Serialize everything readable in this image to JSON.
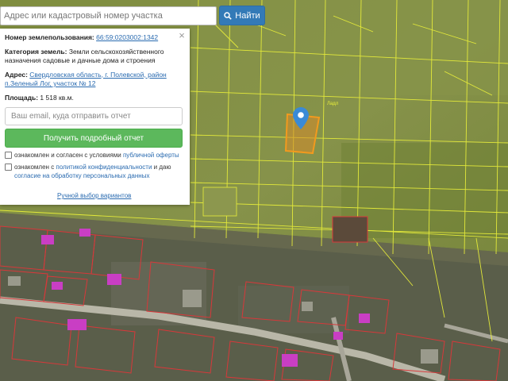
{
  "search": {
    "placeholder": "Адрес или кадастровый номер участка",
    "button_label": "Найти"
  },
  "panel": {
    "cadastral_label": "Номер землепользования:",
    "cadastral_number": "66:59:0203002:1342",
    "category_label": "Категория земель:",
    "category_value": "Земли сельскохозяйственного назначения садовые и дачные дома и строения",
    "address_label": "Адрес:",
    "address_value": "Свердловская область, г. Полевской, район п.Зеленый Лог, участок № 12",
    "area_label": "Площадь:",
    "area_value": "1 518 кв.м.",
    "email_placeholder": "Ваш email, куда отправить отчет",
    "report_button": "Получить подробный отчет",
    "consent1_text": "ознакомлен и согласен с условиями ",
    "consent1_link": "публичной оферты",
    "consent2_text": "ознакомлен с ",
    "consent2_link1": "политикой конфиденциальности",
    "consent2_mid": " и даю ",
    "consent2_link2": "согласие на обработку персональных данных",
    "manual_link": "Ручной выбор вариантов",
    "close_glyph": "×"
  },
  "map": {
    "street_label": "Ладл",
    "icons": [
      "map-pin-icon",
      "search-icon",
      "close-icon"
    ],
    "colors": {
      "parcel_lines": "#e8ee3a",
      "selected_parcel": "#f29a1e",
      "building_outline": "#d8383a",
      "building_fill": "#c93ec4",
      "pin": "#3a8ad6",
      "search_button": "#337ab7",
      "report_button": "#5cb85c"
    }
  }
}
